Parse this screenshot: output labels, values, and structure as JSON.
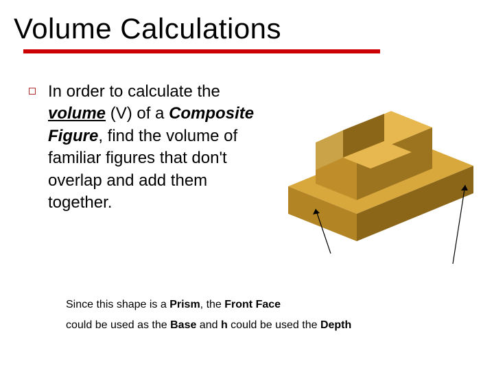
{
  "title": "Volume Calculations",
  "colors": {
    "accent_red": "#cc0000",
    "figure_gold": "#cc9933",
    "figure_light": "#e6c270",
    "figure_dark": "#a67a1f"
  },
  "body": {
    "part1": "In order to calculate the ",
    "volume_word": "volume",
    "part2": " (V) of a ",
    "composite_word": "Composite Figure",
    "part3": ", find the volume of familiar figures that don't overlap and add them together."
  },
  "footnote": {
    "line1_a": "Since this shape is a ",
    "line1_b": "Prism",
    "line1_c": ", the ",
    "line1_d": "Front Face",
    "line2_a": "could be used as the ",
    "line2_b": "Base",
    "line2_c": " and ",
    "line2_d": "h",
    "line2_e": " could be used the ",
    "line2_f": "Depth"
  },
  "icons": {
    "bullet": "square-outline-bullet"
  }
}
